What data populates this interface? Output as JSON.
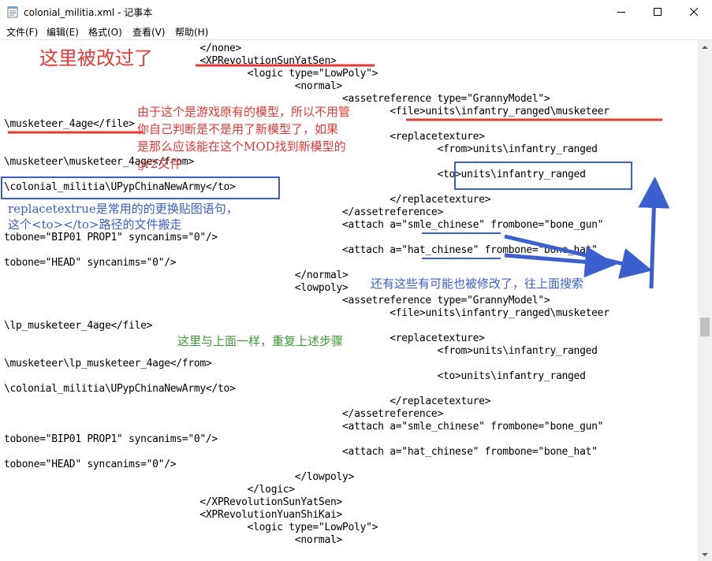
{
  "window": {
    "title": "colonial_militia.xml - 记事本",
    "buttons": [
      "minimize",
      "maximize",
      "close"
    ]
  },
  "menu": {
    "items": [
      "文件(F)",
      "编辑(E)",
      "格式(O)",
      "查看(V)",
      "帮助(H)"
    ]
  },
  "code_lines": [
    "                                 </none>",
    "                                 <XPRevolutionSunYatSen>",
    "                                         <logic type=\"LowPoly\">",
    "                                                 <normal>",
    "                                                         <assetreference type=\"GrannyModel\">",
    "                                                                 <file>units\\infantry_ranged\\musketeer",
    "\\musketeer_4age</file>",
    "                                                                 <replacetexture>",
    "                                                                         <from>units\\infantry_ranged",
    "\\musketeer\\musketeer_4age</from>",
    "                                                                         <to>units\\infantry_ranged",
    "\\colonial_militia\\UPypChinaNewArmy</to>",
    "                                                                 </replacetexture>",
    "                                                         </assetreference>",
    "                                                         <attach a=\"smle_chinese\" frombone=\"bone_gun\"",
    "tobone=\"BIP01 PROP1\" syncanims=\"0\"/>",
    "                                                         <attach a=\"hat_chinese\" frombone=\"bone_hat\"",
    "tobone=\"HEAD\" syncanims=\"0\"/>",
    "                                                 </normal>",
    "                                                 <lowpoly>",
    "                                                         <assetreference type=\"GrannyModel\">",
    "                                                                 <file>units\\infantry_ranged\\musketeer",
    "\\lp_musketeer_4age</file>",
    "                                                                 <replacetexture>",
    "                                                                         <from>units\\infantry_ranged",
    "\\musketeer\\lp_musketeer_4age</from>",
    "                                                                         <to>units\\infantry_ranged",
    "\\colonial_militia\\UPypChinaNewArmy</to>",
    "                                                                 </replacetexture>",
    "                                                         </assetreference>",
    "                                                         <attach a=\"smle_chinese\" frombone=\"bone_gun\"",
    "tobone=\"BIP01 PROP1\" syncanims=\"0\"/>",
    "                                                         <attach a=\"hat_chinese\" frombone=\"bone_hat\"",
    "tobone=\"HEAD\" syncanims=\"0\"/>",
    "                                                 </lowpoly>",
    "                                         </logic>",
    "                                 </XPRevolutionSunYatSen>",
    "                                 <XPRevolutionYuanShiKai>",
    "                                         <logic type=\"LowPoly\">",
    "                                                 <normal>"
  ],
  "annotations": {
    "modified_here": "这里被改过了",
    "original_model_note": "由于这个是游戏原有的模型，所以不用管\n你自己判断是不是用了新模型了，如果\n是那么应该能在这个MOD找到新模型的\ngr2文件",
    "replacetexture_note": "replacetextrue是常用的的更换贴图语句，\n这个<to></to>路径的文件搬走",
    "may_be_modified_note": "还有这些有可能也被修改了，往上面搜索",
    "repeat_steps_note": "这里与上面一样，重复上述步骤"
  },
  "colors": {
    "annotation_red": "#e53935",
    "annotation_blue": "#3b5fce",
    "annotation_green": "#3c9a36"
  }
}
